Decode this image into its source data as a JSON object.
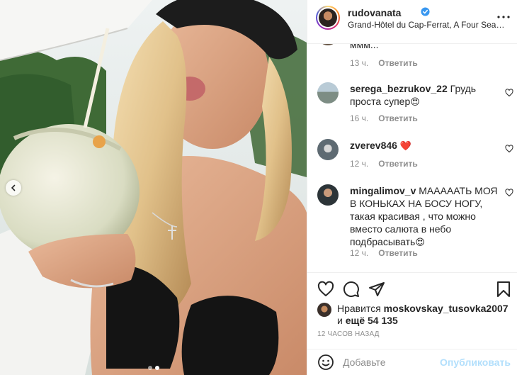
{
  "post": {
    "username": "rudovanata",
    "verified": true,
    "location": "Grand-Hôtel du Cap-Ferrat, A Four Seaso..."
  },
  "icons": {
    "more": "more-dots-icon",
    "like": "heart-outline-icon",
    "comment": "comment-bubble-icon",
    "share": "paper-plane-icon",
    "save": "bookmark-icon",
    "emoji": "smiley-icon",
    "prev": "chevron-left-icon"
  },
  "comments": [
    {
      "username": "",
      "text": "ммм...",
      "time": "13 ч.",
      "reply": "Ответить"
    },
    {
      "username": "serega_bezrukov_22",
      "text": "Грудь проста супер",
      "emoji": "😍",
      "time": "16 ч.",
      "reply": "Ответить"
    },
    {
      "username": "zverev846",
      "text": "",
      "emoji": "❤️",
      "time": "12 ч.",
      "reply": "Ответить"
    },
    {
      "username": "mingalimov_v",
      "text": "МАААААТЬ МОЯ В КОНЬКАХ НА БОСУ НОГУ, такая красивая , что можно вместо салюта в небо подбрасывать",
      "emoji": "😍",
      "time": "12 ч.",
      "reply": "Ответить"
    }
  ],
  "likes": {
    "prefix": "Нравится",
    "user": "moskovskay_tusovka2007",
    "conj": "и",
    "more_prefix": "ещё",
    "count": "54 135"
  },
  "timestamp": "12 часов назад",
  "composer": {
    "placeholder": "Добавьте",
    "publish_label": "Опубликовать"
  },
  "colors": {
    "verified": "#3897f0",
    "heart_red": "#ed4956",
    "publish_disabled": "#b2dffc",
    "meta_gray": "#8e8e8e"
  },
  "carousel": {
    "total": 2,
    "active": 2
  }
}
